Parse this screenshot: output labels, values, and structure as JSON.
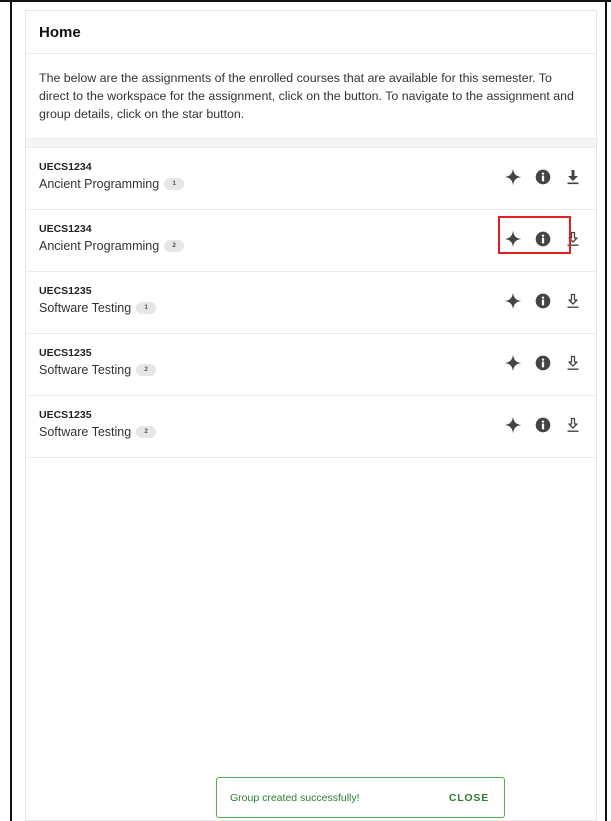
{
  "header": {
    "title": "Home"
  },
  "intro": {
    "text": "The below are the assignments of the enrolled courses that are available for this semester. To direct to the workspace for the assignment, click on the button. To navigate to the assignment and group details, click on the star button."
  },
  "assignments": [
    {
      "code": "UECS1234",
      "name": "Ancient Programming",
      "badge": "1",
      "download_style": "filled"
    },
    {
      "code": "UECS1234",
      "name": "Ancient Programming",
      "badge": "2",
      "download_style": "outline"
    },
    {
      "code": "UECS1235",
      "name": "Software Testing",
      "badge": "1",
      "download_style": "outline"
    },
    {
      "code": "UECS1235",
      "name": "Software Testing",
      "badge": "2",
      "download_style": "outline"
    },
    {
      "code": "UECS1235",
      "name": "Software Testing",
      "badge": "2",
      "download_style": "outline"
    }
  ],
  "icons": {
    "action_1": "star-icon",
    "action_2": "info-icon",
    "action_3": "download-icon"
  },
  "toast": {
    "message": "Group created successfully!",
    "close_label": "CLOSE"
  },
  "colors": {
    "icon": "#444444",
    "highlight": "#e02020",
    "toast_accent": "#4caf50",
    "toast_text": "#2e7d32"
  }
}
